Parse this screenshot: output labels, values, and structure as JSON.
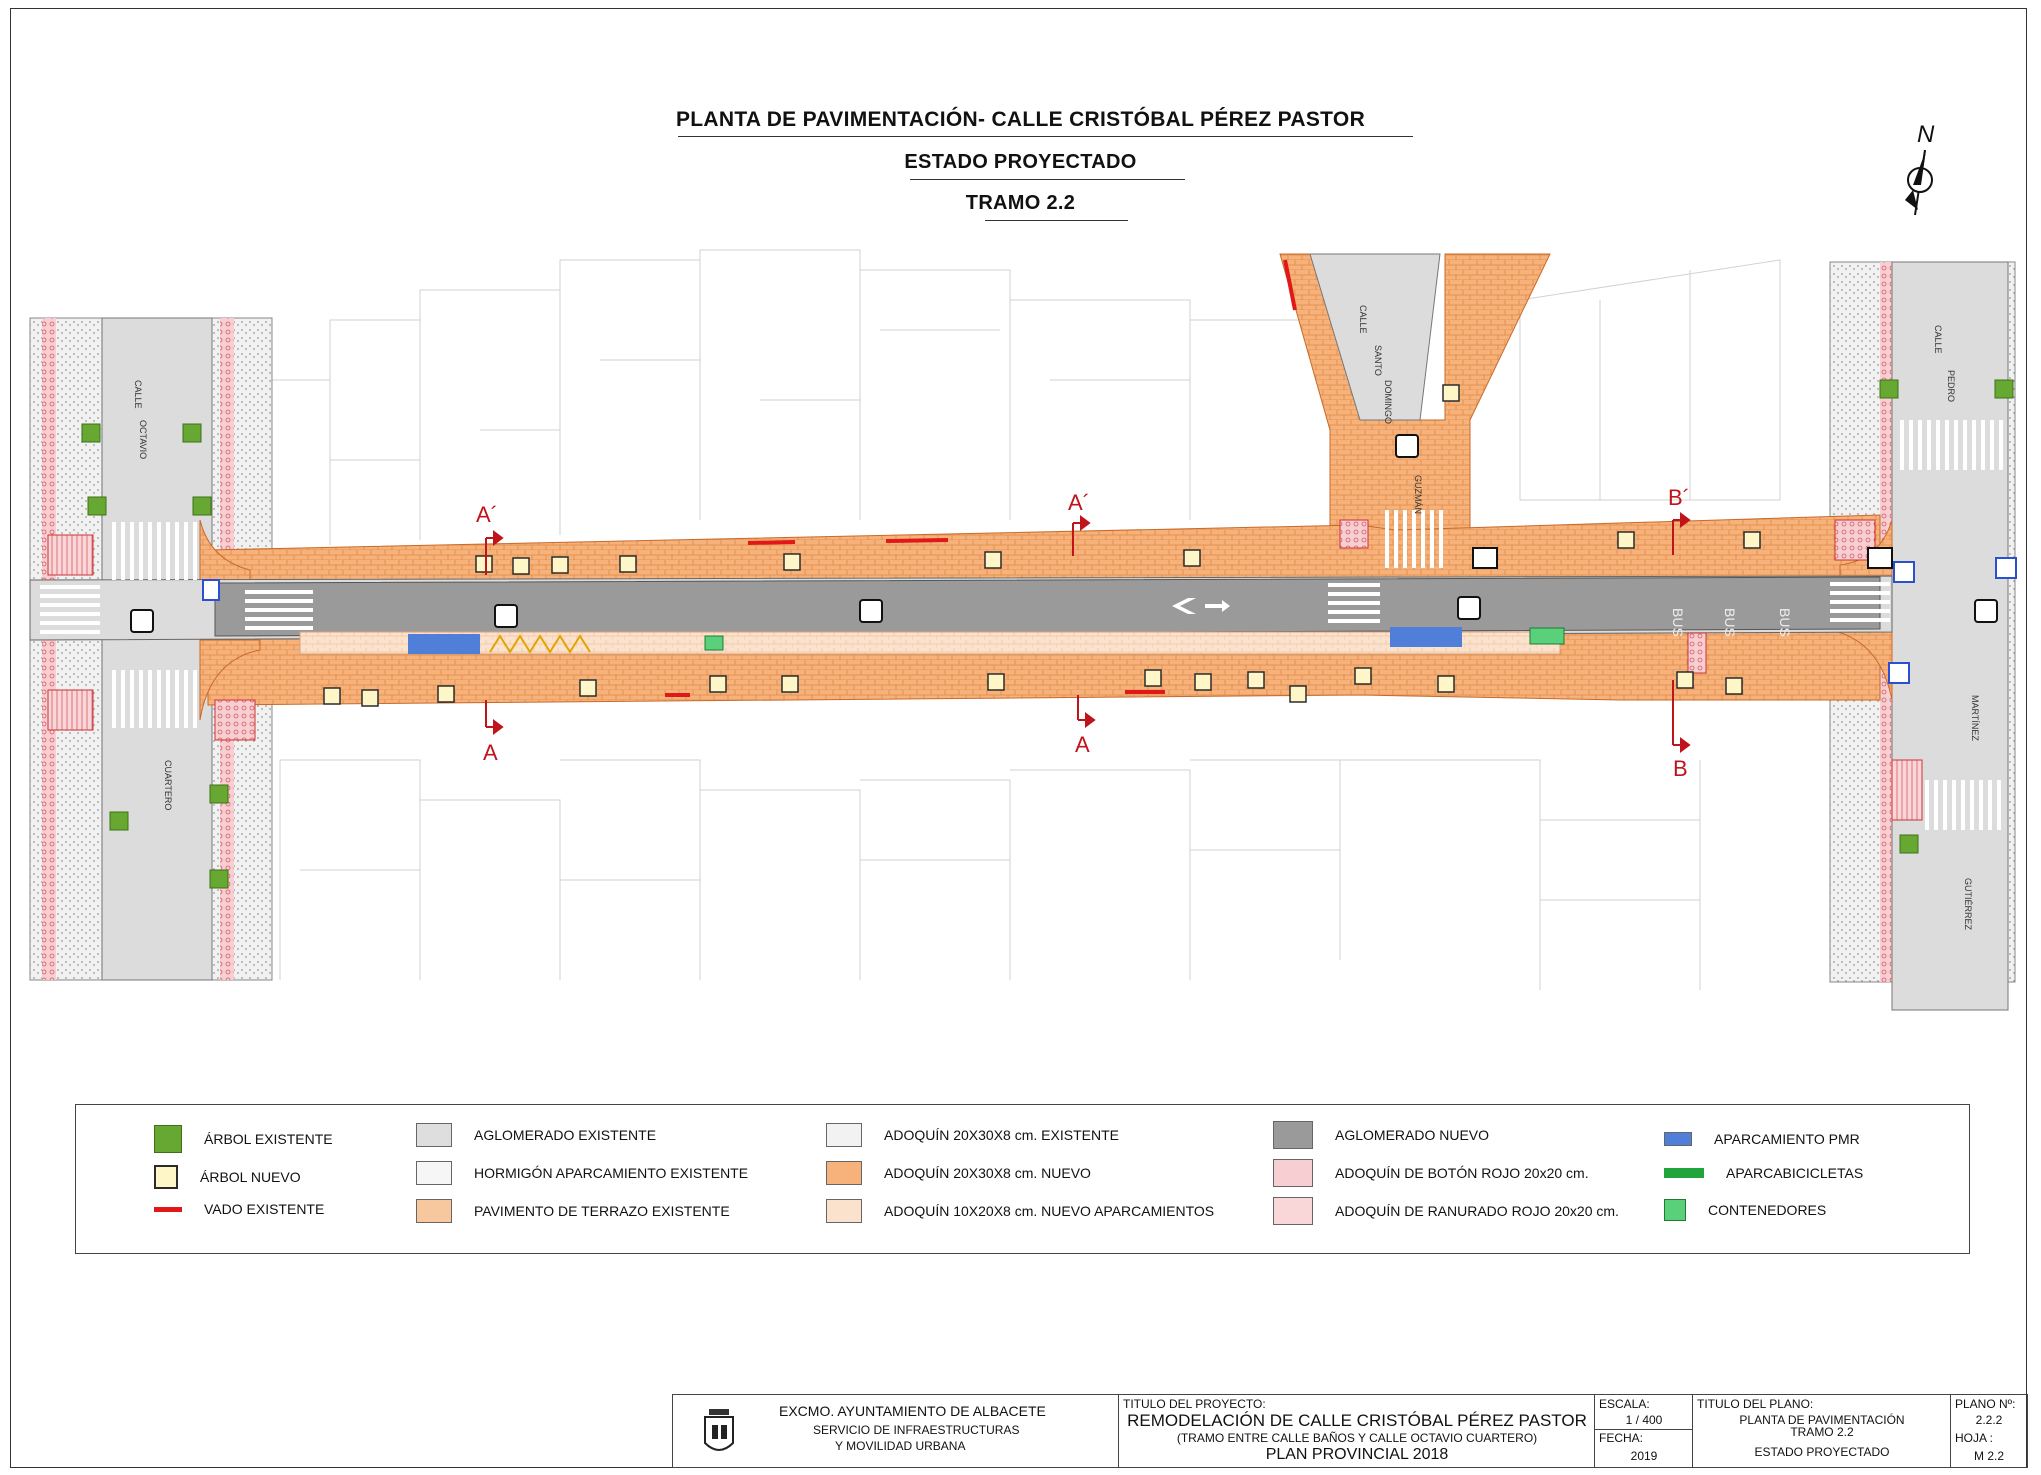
{
  "titles": {
    "main": "PLANTA DE PAVIMENTACIÓN- CALLE  CRISTÓBAL  PÉREZ  PASTOR",
    "state": "ESTADO PROYECTADO",
    "section": "TRAMO 2.2"
  },
  "north": "N",
  "streets": {
    "calle_octavio_a": "CALLE",
    "calle_octavio_b": "OCTAVIO",
    "cuartero": "CUARTERO",
    "santo_domingo_a": "CALLE",
    "santo_domingo_b": "SANTO",
    "santo_domingo_c": "DOMINGO",
    "guzman": "GUZMÁN",
    "pedro_a": "CALLE",
    "pedro_b": "PEDRO",
    "martinez": "MARTÍNEZ",
    "gutierrez": "GUTIÉRREZ"
  },
  "sections": {
    "a_top1": "A´",
    "a_bot1": "A",
    "a_top2": "A´",
    "a_bot2": "A",
    "b_top": "B´",
    "b_bot": "B"
  },
  "road_text": {
    "bus1": "BUS",
    "bus2": "BUS",
    "bus3": "BUS"
  },
  "legend": [
    {
      "label": "ÁRBOL  EXISTENTE",
      "swatch": "tree-existing"
    },
    {
      "label": "ÁRBOL  NUEVO",
      "swatch": "tree-new"
    },
    {
      "label": "VADO  EXISTENTE",
      "swatch": "vado"
    },
    {
      "label": "AGLOMERADO   EXISTENTE",
      "swatch": "#dedede"
    },
    {
      "label": "HORMIGÓN APARCAMIENTO EXISTENTE",
      "swatch": "#f6f6f6"
    },
    {
      "label": "PAVIMENTO DE TERRAZO  EXISTENTE",
      "swatch": "#f7c89e"
    },
    {
      "label": "ADOQUÍN 20X30X8 cm.  EXISTENTE",
      "swatch": "#f2f2f2"
    },
    {
      "label": "ADOQUÍN 20X30X8 cm. NUEVO",
      "swatch": "#f6b27a"
    },
    {
      "label": "ADOQUÍN 10X20X8 cm. NUEVO APARCAMIENTOS",
      "swatch": "#fbe2cc"
    },
    {
      "label": "AGLOMERADO   NUEVO",
      "swatch": "#9a9a9a"
    },
    {
      "label": "ADOQUÍN DE BOTÓN ROJO 20x20 cm.",
      "swatch": "#f7cfd2"
    },
    {
      "label": "ADOQUÍN DE RANURADO ROJO 20x20 cm.",
      "swatch": "#f9d6d8"
    },
    {
      "label": "APARCAMIENTO PMR",
      "swatch": "#4f7fd8"
    },
    {
      "label": "APARCABICICLETAS",
      "swatch": "#1fa53b"
    },
    {
      "label": "CONTENEDORES",
      "swatch": "#5bd07a"
    }
  ],
  "titleblock": {
    "org": "EXCMO. AYUNTAMIENTO DE ALBACETE",
    "dept1": "SERVICIO DE INFRAESTRUCTURAS",
    "dept2": "Y MOVILIDAD URBANA",
    "proj_label": "TITULO DEL PROYECTO:",
    "proj_name": "REMODELACIÓN DE CALLE  CRISTÓBAL  PÉREZ  PASTOR",
    "proj_sub": "(TRAMO ENTRE CALLE BAÑOS Y CALLE OCTAVIO CUARTERO)",
    "proj_plan": "PLAN PROVINCIAL 2018",
    "scale_label": "ESCALA:",
    "scale": "1 / 400",
    "date_label": "FECHA:",
    "date": "2019",
    "plan_label": "TITULO DEL PLANO:",
    "plan1": "PLANTA  DE PAVIMENTACIÓN",
    "plan2": "TRAMO 2.2",
    "plan3": "ESTADO PROYECTADO",
    "num_label": "PLANO Nº:",
    "num": "2.2.2",
    "sheet_label": "HOJA :",
    "sheet": "M 2.2"
  }
}
